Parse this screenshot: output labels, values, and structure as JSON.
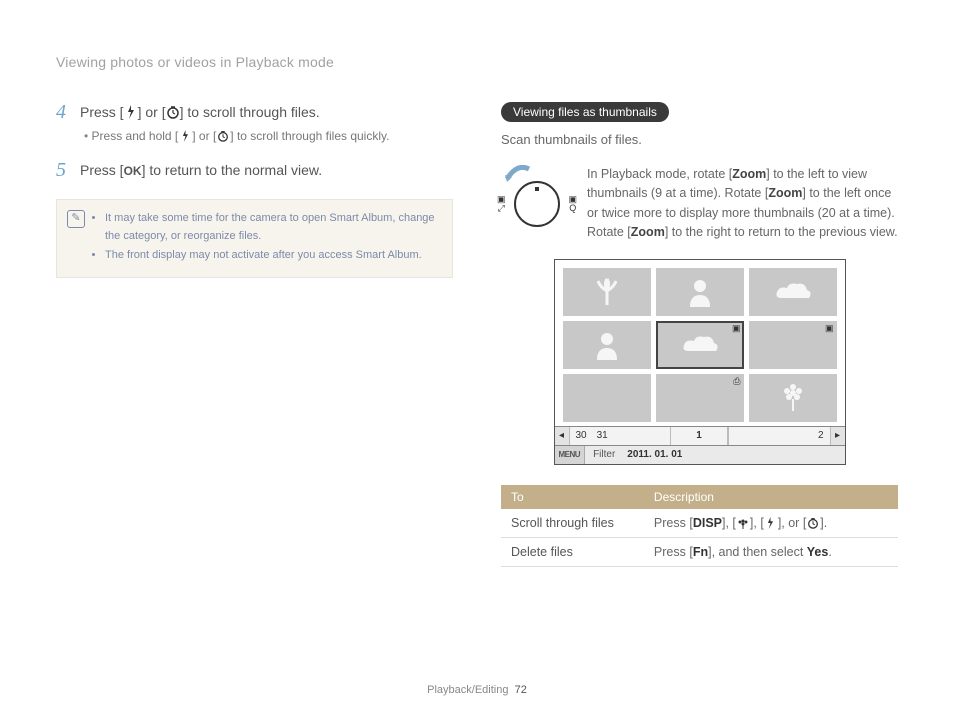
{
  "header": {
    "title": "Viewing photos or videos in Playback mode"
  },
  "left": {
    "step4": {
      "num": "4",
      "pre": "Press [",
      "mid": "] or [",
      "post": "] to scroll through files.",
      "sub_pre": "Press and hold [",
      "sub_mid": "] or [",
      "sub_post": "] to scroll through files quickly."
    },
    "step5": {
      "num": "5",
      "pre": "Press [",
      "post": "] to return to the normal view.",
      "ok_label": "OK"
    },
    "info": {
      "bullets": [
        "It may take some time for the camera to open Smart Album, change the category, or reorganize files.",
        "The front display may not activate after you access Smart Album."
      ]
    }
  },
  "right": {
    "pill": "Viewing files as thumbnails",
    "scan": "Scan thumbnails of files.",
    "zoom_text": {
      "a": "In Playback mode, rotate [",
      "z1": "Zoom",
      "b": "] to the left to view thumbnails (9 at a time). Rotate [",
      "z2": "Zoom",
      "c": "] to the left once or twice more to display more thumbnails (20 at a time). Rotate [",
      "z3": "Zoom",
      "d": "] to the right to return to the previous view."
    },
    "screen": {
      "dates": {
        "d30": "30",
        "d31": "31",
        "d1": "1",
        "d2": "2"
      },
      "menu_label": "MENU",
      "filter_label": "Filter",
      "date_value": "2011. 01. 01"
    },
    "table": {
      "headers": {
        "to": "To",
        "desc": "Description"
      },
      "rows": [
        {
          "to": "Scroll through files",
          "pre": "Press [",
          "disp": "DISP",
          "mid1": "], [",
          "mid2": "], [",
          "mid3": "], or [",
          "post": "]."
        },
        {
          "to": "Delete files",
          "pre": "Press [",
          "fn": "Fn",
          "mid": "], and then select ",
          "yes": "Yes",
          "post": "."
        }
      ]
    }
  },
  "footer": {
    "section": "Playback/Editing",
    "page": "72"
  }
}
